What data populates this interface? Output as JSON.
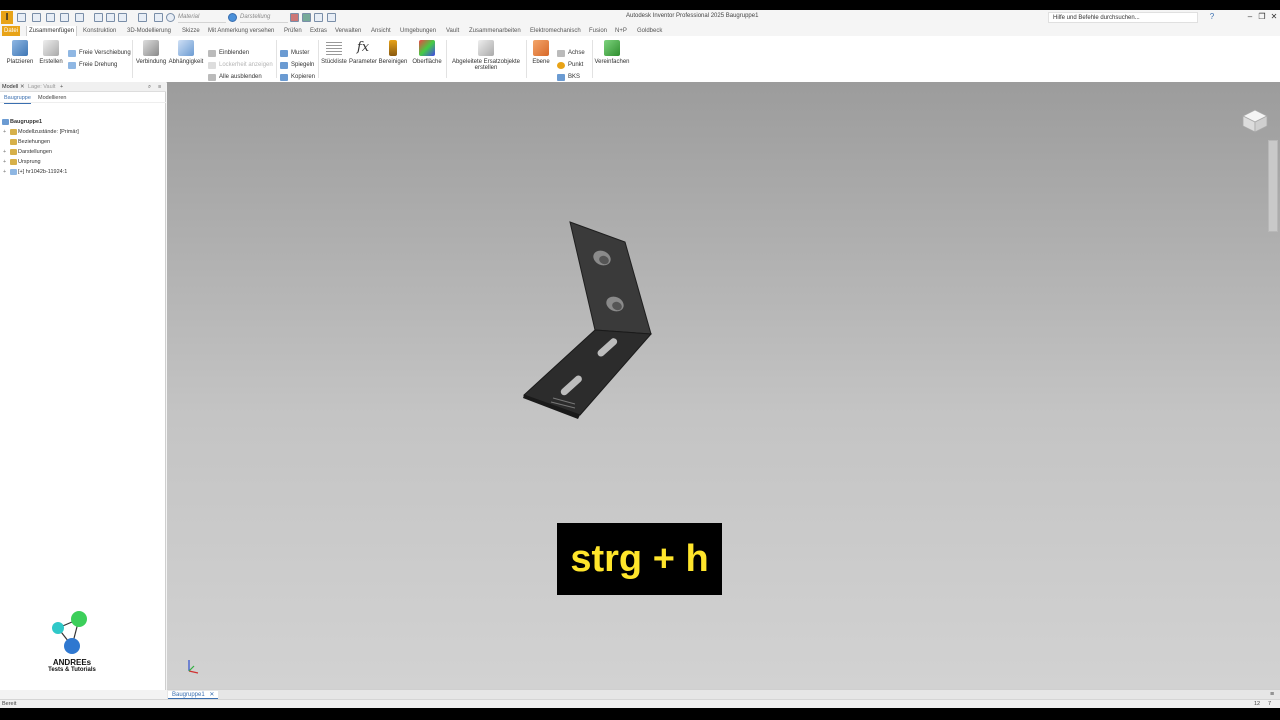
{
  "titlebar": {
    "material_placeholder": "Material",
    "appearance_placeholder": "Darstellung",
    "title": "Autodesk Inventor Professional 2025   Baugruppe1",
    "search_text": "Hilfe und Befehle durchsuchen..."
  },
  "ribbon_tabs": [
    "Datei",
    "Zusammenfügen",
    "Konstruktion",
    "3D-Modellierung",
    "Skizze",
    "Mit Anmerkung versehen",
    "Prüfen",
    "Extras",
    "Verwalten",
    "Ansicht",
    "Umgebungen",
    "Vault",
    "Zusammenarbeiten",
    "Elektromechanisch",
    "Fusion",
    "N+P",
    "Goldbeck"
  ],
  "ribbon": {
    "place": "Platzieren",
    "create": "Erstellen",
    "free_move": "Freie Verschiebung",
    "free_rotate": "Freie Drehung",
    "joint": "Verbindung",
    "constrain": "Abhängigkeit",
    "show": "Einblenden",
    "show_sick": "Lockerheit anzeigen",
    "hide_all": "Alle ausblenden",
    "pattern": "Muster",
    "mirror": "Spiegeln",
    "copy": "Kopieren",
    "bom": "Stückliste",
    "parameters": "Parameter",
    "purge": "Bereinigen",
    "surface": "Oberfläche",
    "derived_line1": "Abgeleitete Ersatzobjekte",
    "derived_line2": "erstellen",
    "plane": "Ebene",
    "axis": "Achse",
    "point": "Punkt",
    "ucs": "BKS",
    "simplify": "Vereinfachen"
  },
  "browser": {
    "tab_model": "Modell",
    "tab_vault": "Lage: Vault",
    "sub_assembly": "Baugruppe",
    "sub_model": "Modellieren",
    "tree": [
      {
        "label": "Baugruppe1",
        "plus": "",
        "root": true
      },
      {
        "label": "Modellzustände: [Primär]",
        "plus": "+"
      },
      {
        "label": "Beziehungen",
        "plus": ""
      },
      {
        "label": "Darstellungen",
        "plus": "+"
      },
      {
        "label": "Ursprung",
        "plus": "+"
      },
      {
        "label": "[+] hr1042b-11924:1",
        "plus": "+"
      }
    ]
  },
  "logo": {
    "line1": "ANDREEs",
    "line2": "Tests & Tutorials"
  },
  "overlay": {
    "shortcut": "strg + h"
  },
  "doc_tab": "Baugruppe1",
  "status": {
    "text": "Bereit",
    "count1": "12",
    "count2": "7"
  },
  "colors": {
    "file_tab": "#e8a317",
    "accent_blue": "#3a6fb0",
    "shortcut_text": "#ffe52b",
    "part": "#2f2f2f"
  }
}
